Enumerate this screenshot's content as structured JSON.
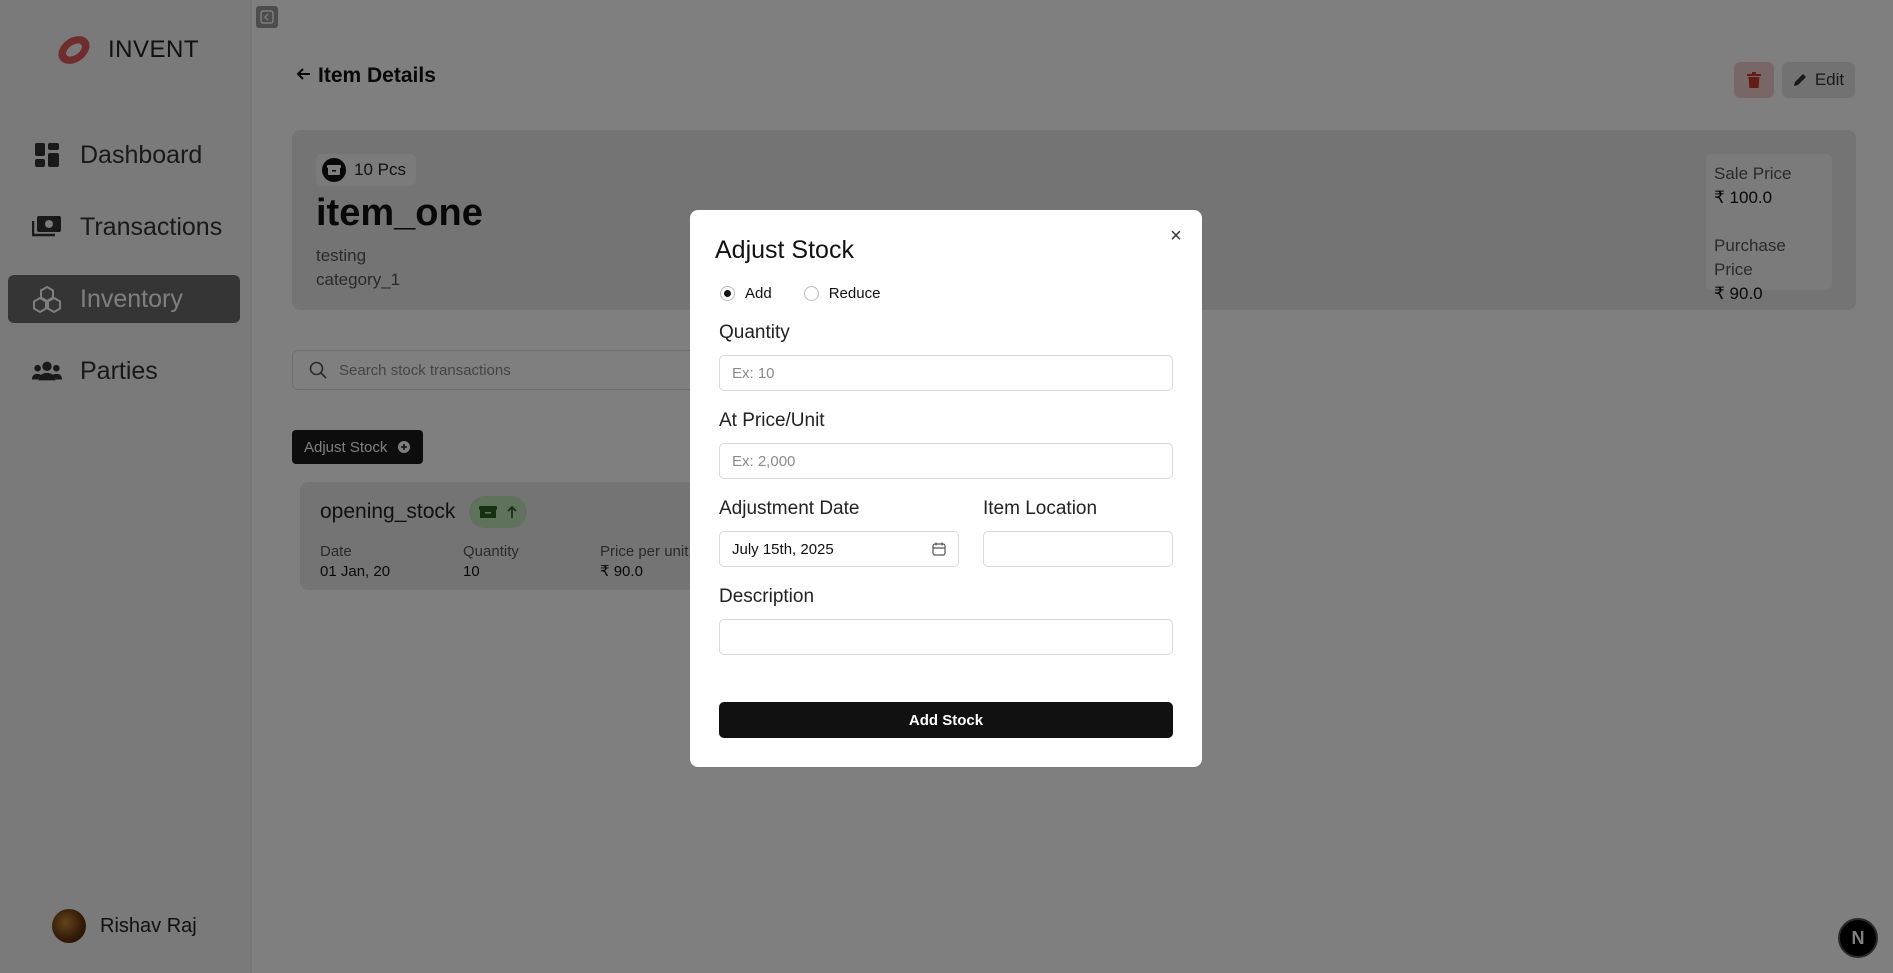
{
  "app": {
    "name": "INVENT"
  },
  "sidebar": {
    "items": [
      {
        "label": "Dashboard",
        "icon": "dashboard-icon",
        "active": false
      },
      {
        "label": "Transactions",
        "icon": "money-icon",
        "active": false
      },
      {
        "label": "Inventory",
        "icon": "cubes-icon",
        "active": true
      },
      {
        "label": "Parties",
        "icon": "users-icon",
        "active": false
      }
    ],
    "user": {
      "name": "Rishav Raj"
    }
  },
  "header": {
    "title": "Item Details",
    "edit_label": "Edit"
  },
  "item": {
    "stock_badge": "10 Pcs",
    "name": "item_one",
    "description": "testing",
    "category": "category_1",
    "sale_price_label": "Sale Price",
    "sale_price": "₹ 100.0",
    "purchase_price_label": "Purchase Price",
    "purchase_price": "₹ 90.0"
  },
  "search": {
    "placeholder": "Search stock transactions"
  },
  "adjust_button": {
    "label": "Adjust Stock"
  },
  "transaction": {
    "title": "opening_stock",
    "date_label": "Date",
    "date": "01 Jan, 20",
    "quantity_label": "Quantity",
    "quantity": "10",
    "price_label": "Price per unit",
    "price": "₹ 90.0"
  },
  "badge_n": "N",
  "modal": {
    "title": "Adjust Stock",
    "close": "×",
    "options": {
      "add": "Add",
      "reduce": "Reduce",
      "selected": "Add"
    },
    "quantity_label": "Quantity",
    "quantity_placeholder": "Ex: 10",
    "price_label": "At Price/Unit",
    "price_placeholder": "Ex: 2,000",
    "date_label": "Adjustment Date",
    "date_value": "July 15th, 2025",
    "location_label": "Item Location",
    "description_label": "Description",
    "submit_label": "Add Stock"
  },
  "colors": {
    "accent": "#111111",
    "logo": "#e05a5a",
    "delete": "#c0392b",
    "success_badge": "#bfe5b9"
  }
}
